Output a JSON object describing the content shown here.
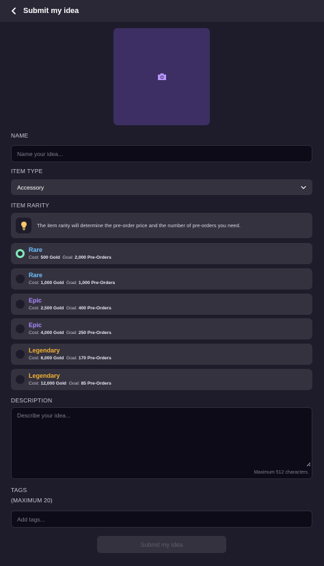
{
  "header": {
    "title": "Submit my idea",
    "back_icon": "chevron-left-icon"
  },
  "image_upload": {
    "icon": "camera-icon"
  },
  "name": {
    "label": "NAME",
    "placeholder": "Name your idea...",
    "value": ""
  },
  "item_type": {
    "label": "ITEM TYPE",
    "selected": "Accessory",
    "icon": "chevron-down-icon"
  },
  "item_rarity": {
    "label": "ITEM RARITY",
    "info": "The item rarity will determine the pre-order price and the number of pre-orders you need.",
    "info_icon": "lightbulb-icon",
    "cost_label": "Cost:",
    "goal_label": "Goal:",
    "options": [
      {
        "name": "Rare",
        "cost": "500 Gold",
        "goal": "2,000 Pre-Orders",
        "selected": true
      },
      {
        "name": "Rare",
        "cost": "1,000 Gold",
        "goal": "1,000 Pre-Orders",
        "selected": false
      },
      {
        "name": "Epic",
        "cost": "2,500 Gold",
        "goal": "400 Pre-Orders",
        "selected": false
      },
      {
        "name": "Epic",
        "cost": "4,000 Gold",
        "goal": "250 Pre-Orders",
        "selected": false
      },
      {
        "name": "Legendary",
        "cost": "6,000 Gold",
        "goal": "170 Pre-Orders",
        "selected": false
      },
      {
        "name": "Legendary",
        "cost": "12,000 Gold",
        "goal": "85 Pre-Orders",
        "selected": false
      }
    ]
  },
  "description": {
    "label": "DESCRIPTION",
    "placeholder": "Describe your idea...",
    "limit_text": "Maximum 512 characters."
  },
  "tags": {
    "label": "TAGS",
    "sublabel": "(MAXIMUM 20)",
    "placeholder": "Add tags..."
  },
  "submit": {
    "label": "Submit my idea"
  },
  "colors": {
    "rare": "#6ec1ff",
    "epic": "#a98bff",
    "legendary": "#f2b232",
    "selected_radio": "#7fe8b7",
    "image_placeholder": "#3d2f63"
  }
}
